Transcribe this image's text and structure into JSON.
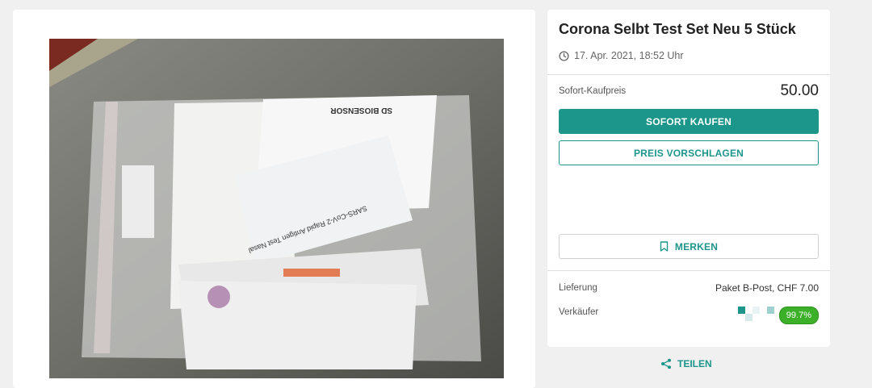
{
  "listing": {
    "title": "Corona Selbt Test Set Neu 5 Stück",
    "date": "17. Apr. 2021, 18:52 Uhr",
    "photo_texts": {
      "brand": "SD BIOSENSOR",
      "product": "SARS-CoV-2 Rapid Antigen Test Nasal"
    }
  },
  "purchase": {
    "price_label": "Sofort-Kaufpreis",
    "price_value": "50.00",
    "buy_now_label": "SOFORT KAUFEN",
    "make_offer_label": "PREIS VORSCHLAGEN",
    "watch_label": "MERKEN"
  },
  "details": {
    "delivery_label": "Lieferung",
    "delivery_value": "Paket B-Post, CHF 7.00",
    "seller_label": "Verkäufer",
    "seller_rating": "99.7%"
  },
  "share_label": "TEILEN",
  "icons": {
    "clock": "clock-icon",
    "bookmark": "bookmark-icon",
    "share": "share-icon"
  },
  "colors": {
    "accent": "#1c958a",
    "rating_badge": "#3bb028"
  }
}
